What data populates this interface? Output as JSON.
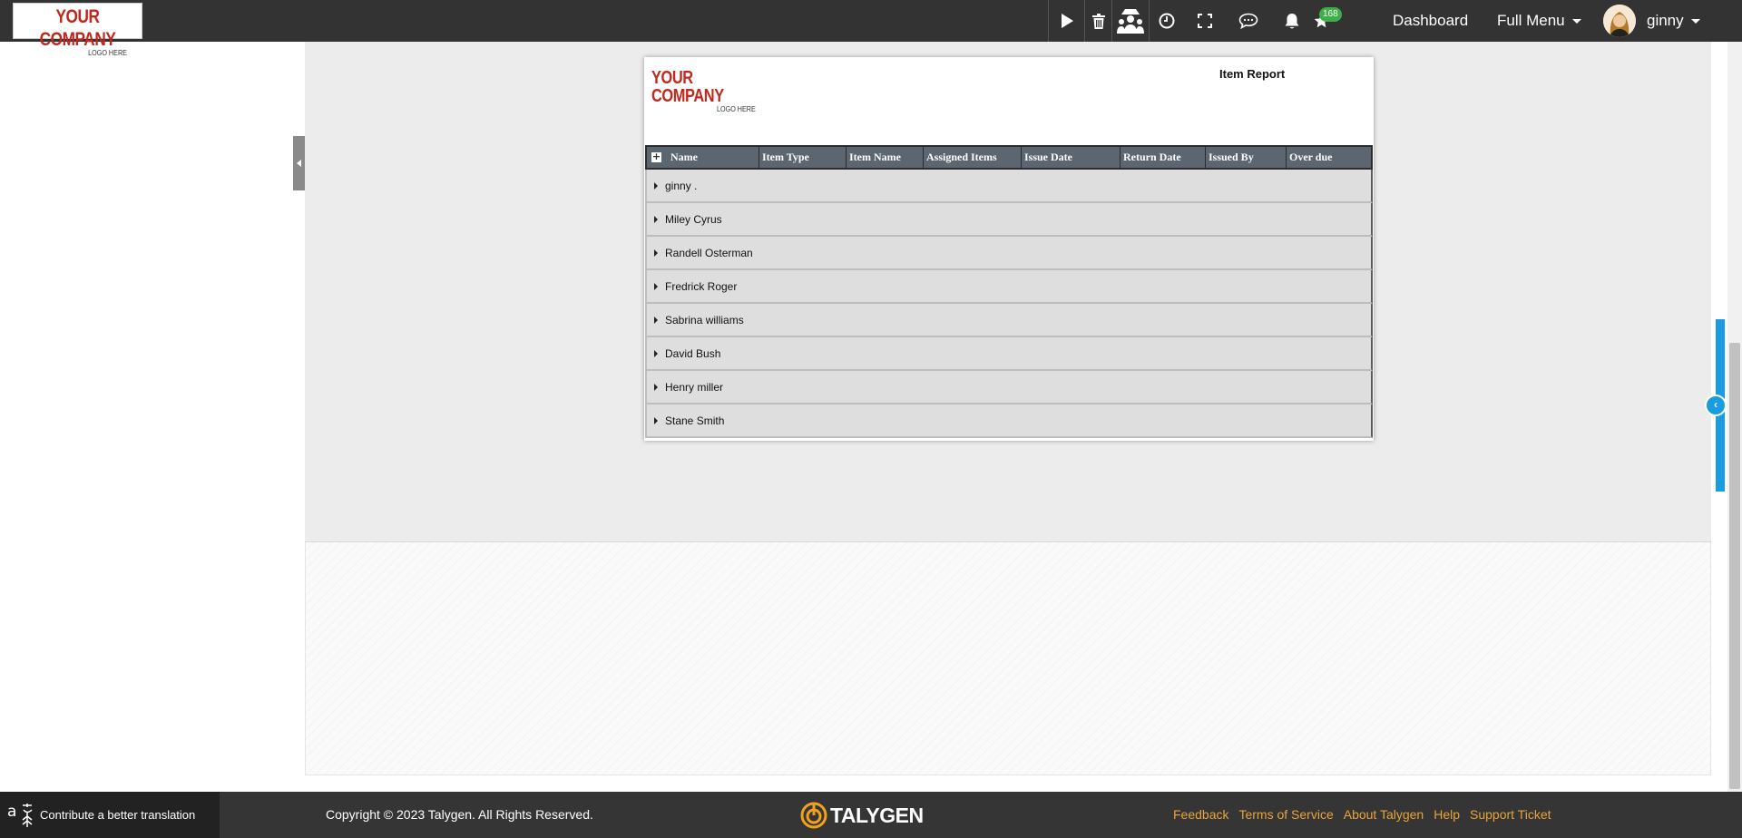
{
  "topbar": {
    "logo_line1": "YOUR COMPANY",
    "logo_line2": "LOGO HERE",
    "notification_count": "168",
    "dashboard_label": "Dashboard",
    "full_menu_label": "Full Menu",
    "user_name": "ginny",
    "icons": [
      "play-icon",
      "trash-icon",
      "team-icon",
      "clock-icon",
      "fullscreen-icon",
      "chat-icon",
      "bell-icon",
      "star-icon"
    ]
  },
  "report": {
    "logo_line1": "YOUR COMPANY",
    "logo_line2": "LOGO HERE",
    "title": "Item Report",
    "columns": [
      "Name",
      "Item Type",
      "Item Name",
      "Assigned Items",
      "Issue Date",
      "Return Date",
      "Issued By",
      "Over due"
    ],
    "rows": [
      "ginny .",
      "Miley Cyrus",
      "Randell Osterman",
      "Fredrick Roger",
      "Sabrina williams",
      "David Bush",
      "Henry miller",
      "Stane Smith"
    ]
  },
  "footer": {
    "contribute_label": "Contribute a better translation",
    "copyright": "Copyright © 2023 Talygen. All Rights Reserved.",
    "brand": "TALYGEN",
    "links": [
      "Feedback",
      "Terms of Service",
      "About Talygen",
      "Help",
      "Support Ticket"
    ]
  },
  "colors": {
    "topbar": "#333333",
    "accent_blue": "#1a9de0",
    "link_orange": "#e8a43a",
    "logo_red": "#c0281e",
    "badge_green": "#3fae49"
  }
}
